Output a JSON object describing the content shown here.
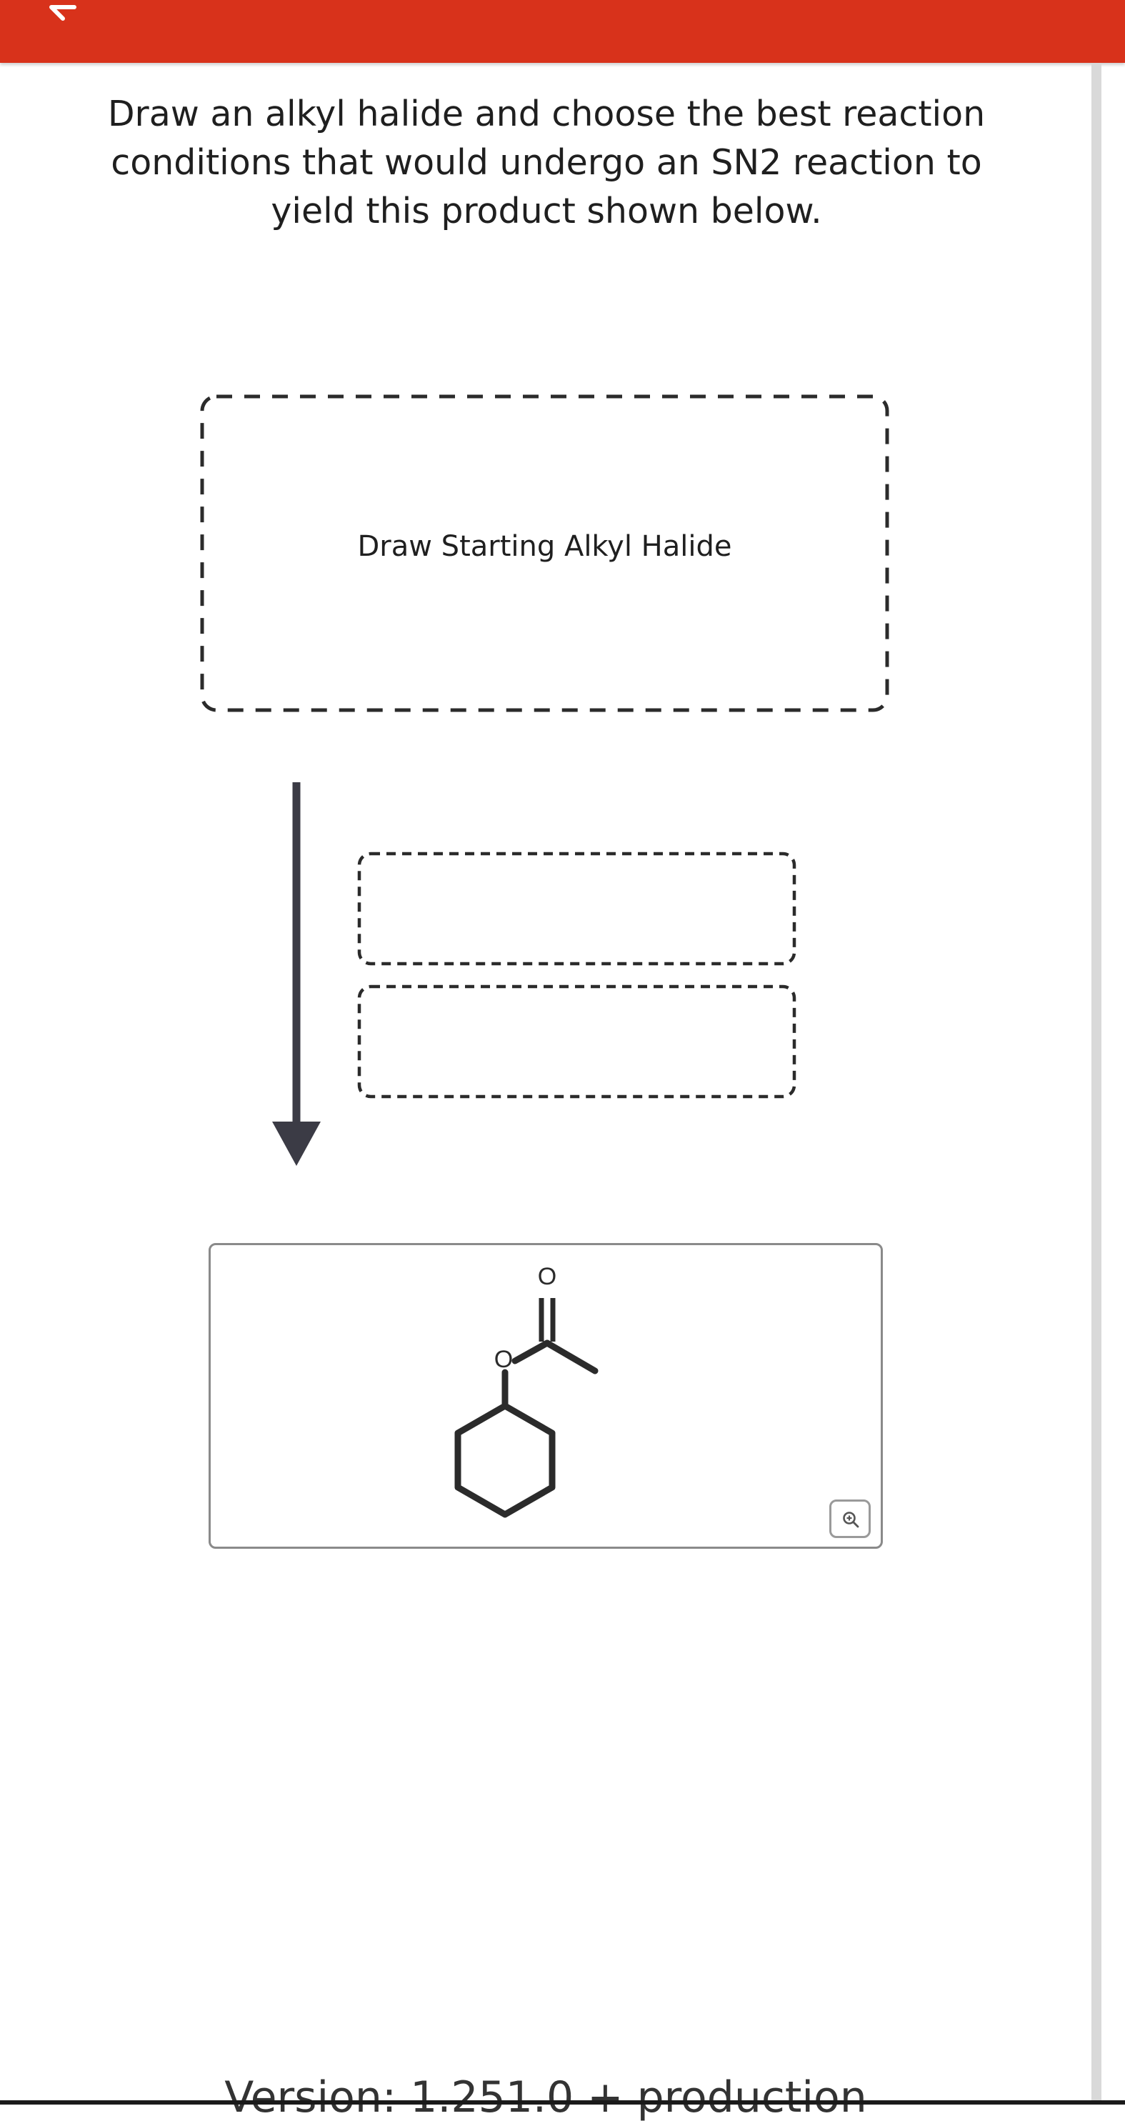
{
  "header": {
    "back_icon": "back-arrow-icon",
    "bar_color": "#d8321b"
  },
  "question": {
    "prompt": "Draw an alkyl halide and choose the best reaction conditions that would undergo an SN2 reaction to yield this product shown below."
  },
  "starting_material": {
    "placeholder": "Draw Starting Alkyl Halide"
  },
  "conditions": {
    "slots": [
      "",
      ""
    ]
  },
  "product": {
    "atom_labels": [
      "O",
      "O"
    ],
    "zoom_icon": "zoom-in-icon"
  },
  "footer": {
    "version_text": "Version: 1.251.0 + production"
  }
}
